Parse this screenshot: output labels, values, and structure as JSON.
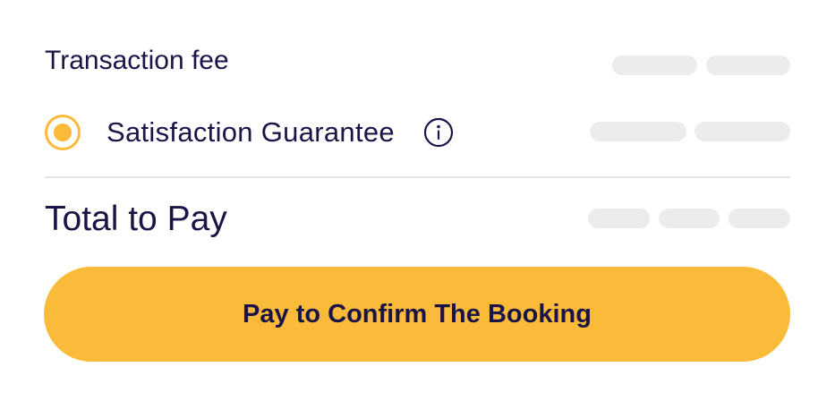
{
  "transaction_fee": {
    "label": "Transaction fee"
  },
  "satisfaction_guarantee": {
    "label": "Satisfaction Guarantee",
    "selected": true,
    "info_icon": "info-icon"
  },
  "total": {
    "label": "Total to Pay"
  },
  "pay_button": {
    "label": "Pay to Confirm The Booking"
  },
  "colors": {
    "accent": "#fbbb3a",
    "text": "#1b1446",
    "skeleton": "#ececec",
    "divider": "#e3e3e6"
  }
}
